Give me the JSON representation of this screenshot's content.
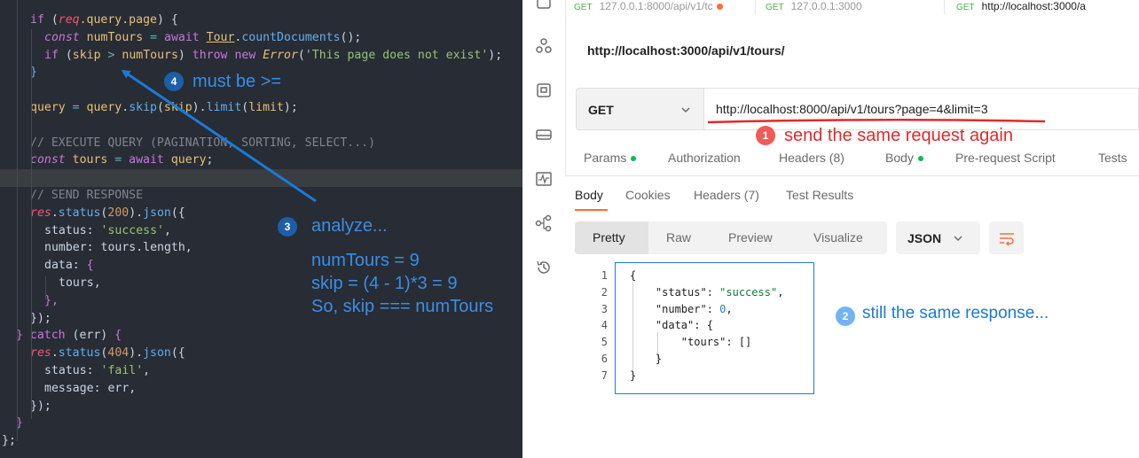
{
  "editor": {
    "lines": [
      [
        [
          "if ",
          "k"
        ],
        [
          "(",
          "p"
        ],
        [
          "req",
          "v"
        ],
        [
          ".query.page",
          "y"
        ],
        [
          ") {",
          "p"
        ]
      ],
      [
        [
          "const ",
          "i"
        ],
        [
          "numTours",
          "y"
        ],
        [
          " = ",
          "o"
        ],
        [
          "await ",
          "k"
        ],
        [
          "Tour",
          "u"
        ],
        [
          ".",
          "p"
        ],
        [
          "countDocuments",
          "f"
        ],
        [
          "();",
          "p"
        ]
      ],
      [
        [
          "if ",
          "k"
        ],
        [
          "(",
          "p"
        ],
        [
          "skip",
          "y"
        ],
        [
          " > ",
          "o"
        ],
        [
          "numTours",
          "y"
        ],
        [
          ") ",
          "p"
        ],
        [
          "throw ",
          "k"
        ],
        [
          "new ",
          "k"
        ],
        [
          "Error",
          "ty"
        ],
        [
          "(",
          "p"
        ],
        [
          "'This page does not exist'",
          "s"
        ],
        [
          ");",
          "p"
        ]
      ],
      [
        [
          "}",
          "f"
        ]
      ],
      [],
      [
        [
          "query",
          "y"
        ],
        [
          " = ",
          "o"
        ],
        [
          "query",
          "y"
        ],
        [
          ".",
          "p"
        ],
        [
          "skip",
          "f"
        ],
        [
          "(",
          "p"
        ],
        [
          "skip",
          "y"
        ],
        [
          ").",
          "p"
        ],
        [
          "limit",
          "f"
        ],
        [
          "(",
          "p"
        ],
        [
          "limit",
          "y"
        ],
        [
          ");",
          "p"
        ]
      ],
      [],
      [
        [
          "// EXECUTE QUERY (PAGINATION, SORTING, SELECT...)",
          "c"
        ]
      ],
      [
        [
          "const ",
          "i"
        ],
        [
          "tours",
          "y"
        ],
        [
          " = ",
          "o"
        ],
        [
          "await ",
          "k"
        ],
        [
          "query",
          "y"
        ],
        [
          ";",
          "p"
        ]
      ],
      [],
      [
        [
          "// SEND RESPONSE",
          "c"
        ]
      ],
      [
        [
          "res",
          "v"
        ],
        [
          ".",
          "p"
        ],
        [
          "status",
          "f"
        ],
        [
          "(",
          "p"
        ],
        [
          "200",
          "n"
        ],
        [
          ").",
          "p"
        ],
        [
          "json",
          "f"
        ],
        [
          "({",
          "p"
        ]
      ],
      [
        [
          "status: ",
          "p"
        ],
        [
          "'success'",
          "s"
        ],
        [
          ",",
          "p"
        ]
      ],
      [
        [
          "number: tours.length,",
          "p"
        ]
      ],
      [
        [
          "data: ",
          "p"
        ],
        [
          "{",
          "k"
        ]
      ],
      [
        [
          "tours,",
          "p"
        ]
      ],
      [
        [
          "},",
          "k"
        ]
      ],
      [
        [
          "});",
          "p"
        ]
      ],
      [
        [
          "} ",
          "k"
        ],
        [
          "catch ",
          "k"
        ],
        [
          "(err) ",
          "p"
        ],
        [
          "{",
          "k"
        ]
      ],
      [
        [
          "res",
          "v"
        ],
        [
          ".",
          "p"
        ],
        [
          "status",
          "f"
        ],
        [
          "(",
          "p"
        ],
        [
          "404",
          "n"
        ],
        [
          ").",
          "p"
        ],
        [
          "json",
          "f"
        ],
        [
          "({",
          "p"
        ]
      ],
      [
        [
          "status: ",
          "p"
        ],
        [
          "'fail'",
          "s"
        ],
        [
          ",",
          "p"
        ]
      ],
      [
        [
          "message: err,",
          "p"
        ]
      ],
      [
        [
          "});",
          "p"
        ]
      ],
      [
        [
          "}",
          "k"
        ]
      ],
      [
        [
          "};",
          "p"
        ]
      ]
    ]
  },
  "tabs": [
    {
      "method": "GET",
      "label": "127.0.0.1:8000/api/v1/tc"
    },
    {
      "method": "GET",
      "label": "127.0.0.1:3000"
    },
    {
      "method": "GET",
      "label": "http://localhost:3000/a"
    }
  ],
  "request": {
    "title": "http://localhost:3000/api/v1/tours/",
    "method": "GET",
    "url": "http://localhost:8000/api/v1/tours?page=4&limit=3"
  },
  "request_tabs": [
    "Params",
    "Authorization",
    "Headers (8)",
    "Body",
    "Pre-request Script",
    "Tests"
  ],
  "response_tabs": [
    "Body",
    "Cookies",
    "Headers (7)",
    "Test Results"
  ],
  "view_options": [
    "Pretty",
    "Raw",
    "Preview",
    "Visualize"
  ],
  "format": "JSON",
  "response_lines": [
    {
      "no": "1",
      "text": [
        [
          "{",
          "jk"
        ]
      ]
    },
    {
      "no": "2",
      "text": [
        [
          "    \"status\": ",
          "jk"
        ],
        [
          "\"success\"",
          "js"
        ],
        [
          ",",
          "jk"
        ]
      ]
    },
    {
      "no": "3",
      "text": [
        [
          "    \"number\": ",
          "jk"
        ],
        [
          "0",
          "jn"
        ],
        [
          ",",
          "jk"
        ]
      ]
    },
    {
      "no": "4",
      "text": [
        [
          "    \"data\": {",
          "jk"
        ]
      ]
    },
    {
      "no": "5",
      "text": [
        [
          "        \"tours\": []",
          "jk"
        ]
      ]
    },
    {
      "no": "6",
      "text": [
        [
          "    }",
          "jk"
        ]
      ]
    },
    {
      "no": "7",
      "text": [
        [
          "}",
          "jk"
        ]
      ]
    }
  ],
  "annotations": {
    "a1": {
      "num": "1",
      "text": "send the same request again"
    },
    "a2": {
      "num": "2",
      "text": "still the same response..."
    },
    "a3": {
      "num": "3",
      "text": "analyze...",
      "lines": [
        "numTours = 9",
        "skip = (4 - 1)*3 = 9",
        "So, skip === numTours"
      ]
    },
    "a4": {
      "num": "4",
      "text": "must be >="
    }
  },
  "colors": {
    "accent": "#ff6c37",
    "annotation_red": "#e02a2a",
    "annotation_blue": "#1a7ad9"
  }
}
